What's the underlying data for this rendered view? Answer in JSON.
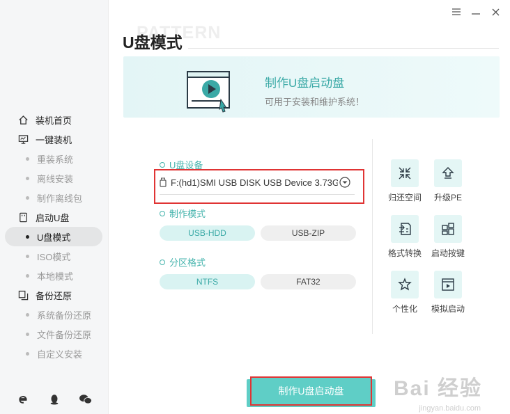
{
  "window": {
    "controls": [
      "menu",
      "minimize",
      "close"
    ]
  },
  "sidebar": {
    "sections": [
      {
        "label": "装机首页",
        "icon": "home-icon"
      },
      {
        "label": "一键装机",
        "icon": "monitor-icon",
        "items": [
          "重装系统",
          "离线安装",
          "制作离线包"
        ]
      },
      {
        "label": "启动U盘",
        "icon": "usb-icon",
        "items": [
          "U盘模式",
          "ISO模式",
          "本地模式"
        ],
        "active": "U盘模式"
      },
      {
        "label": "备份还原",
        "icon": "copy-icon",
        "items": [
          "系统备份还原",
          "文件备份还原",
          "自定义安装"
        ]
      }
    ],
    "footer_icons": [
      "ie-icon",
      "qq-icon",
      "wechat-icon"
    ]
  },
  "header": {
    "watermark_text": "PATTERN",
    "title": "U盘模式"
  },
  "banner": {
    "title": "制作U盘启动盘",
    "subtitle": "可用于安装和维护系统！"
  },
  "form": {
    "device_label": "U盘设备",
    "device_value": "F:(hd1)SMI USB DISK USB Device 3.73G",
    "mode_label": "制作模式",
    "mode_options": [
      "USB-HDD",
      "USB-ZIP"
    ],
    "mode_selected": "USB-HDD",
    "format_label": "分区格式",
    "format_options": [
      "NTFS",
      "FAT32"
    ],
    "format_selected": "NTFS"
  },
  "tools": [
    {
      "label": "归还空间",
      "icon": "restore-space-icon"
    },
    {
      "label": "升级PE",
      "icon": "upgrade-pe-icon"
    },
    {
      "label": "格式转换",
      "icon": "format-convert-icon"
    },
    {
      "label": "启动按键",
      "icon": "boot-key-icon"
    },
    {
      "label": "个性化",
      "icon": "personalize-icon"
    },
    {
      "label": "模拟启动",
      "icon": "simulate-boot-icon"
    }
  ],
  "action": {
    "make_button": "制作U盘启动盘"
  },
  "watermark": {
    "main": "Bai 经验",
    "sub": "jingyan.baidu.com"
  },
  "colors": {
    "accent": "#44b3ac",
    "highlight": "#e03434",
    "button": "#5fcec6"
  }
}
